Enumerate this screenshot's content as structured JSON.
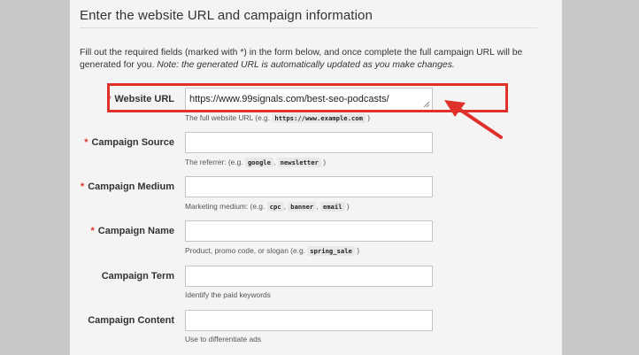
{
  "section": {
    "title": "Enter the website URL and campaign information",
    "intro_main": "Fill out the required fields (marked with *) in the form below, and once complete the full campaign URL will be generated for you.",
    "intro_note": "Note: the generated URL is automatically updated as you make changes."
  },
  "fields": {
    "website_url": {
      "label": "Website URL",
      "required_mark": "*",
      "value": "https://www.99signals.com/best-seo-podcasts/",
      "help_prefix": "The full website URL (e.g.",
      "help_code": "https://www.example.com",
      "help_suffix": ")"
    },
    "campaign_source": {
      "label": "Campaign Source",
      "required_mark": "*",
      "value": "",
      "help_prefix": "The referrer: (e.g.",
      "help_code_1": "google",
      "help_sep": ",",
      "help_code_2": "newsletter",
      "help_suffix": ")"
    },
    "campaign_medium": {
      "label": "Campaign Medium",
      "required_mark": "*",
      "value": "",
      "help_prefix": "Marketing medium: (e.g.",
      "help_code_1": "cpc",
      "help_sep_1": ",",
      "help_code_2": "banner",
      "help_sep_2": ",",
      "help_code_3": "email",
      "help_suffix": ")"
    },
    "campaign_name": {
      "label": "Campaign Name",
      "required_mark": "*",
      "value": "",
      "help_prefix": "Product, promo code, or slogan (e.g.",
      "help_code": "spring_sale",
      "help_suffix": ")"
    },
    "campaign_term": {
      "label": "Campaign Term",
      "value": "",
      "help": "Identify the paid keywords"
    },
    "campaign_content": {
      "label": "Campaign Content",
      "value": "",
      "help": "Use to differentiate ads"
    }
  },
  "colors": {
    "page_bg": "#c8c8c8",
    "panel_bg": "#f4f4f4",
    "required": "#d9342b",
    "annotation": "#e0302a"
  },
  "icons": {
    "resize_grip": "resize-grip-icon",
    "annotation_arrow": "arrow-icon"
  }
}
